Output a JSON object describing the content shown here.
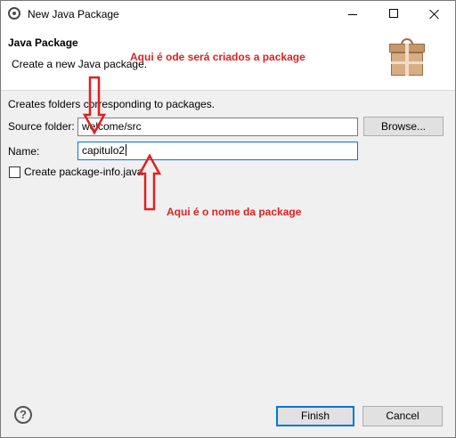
{
  "window": {
    "title": "New Java Package"
  },
  "header": {
    "title": "Java Package",
    "description": "Create a new Java package."
  },
  "body": {
    "description": "Creates folders corresponding to packages.",
    "source_folder": {
      "label": "Source folder:",
      "value": "welcome/src"
    },
    "name": {
      "label": "Name:",
      "value": "capitulo2"
    },
    "browse_label": "Browse...",
    "package_info": {
      "label": "Create package-info.java",
      "checked": false
    }
  },
  "annotations": {
    "source_note": "Aqui é ode será criados a package",
    "name_note": "Aqui é o nome da package",
    "color": "#e02020"
  },
  "footer": {
    "help_symbol": "?",
    "finish_label": "Finish",
    "cancel_label": "Cancel"
  },
  "icons": {
    "app": "eclipse-icon",
    "header": "package-icon",
    "help": "help-icon"
  }
}
